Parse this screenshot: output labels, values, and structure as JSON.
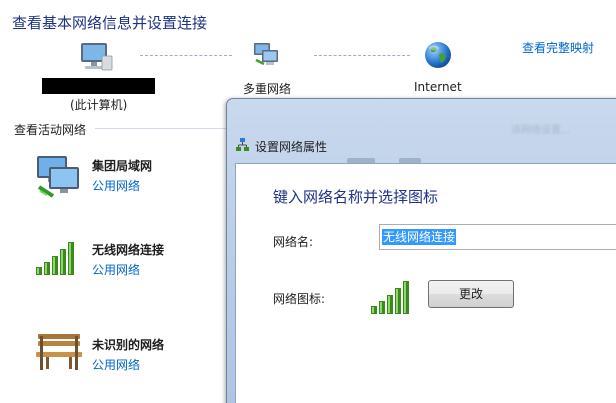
{
  "page": {
    "title": "查看基本网络信息并设置连接",
    "map_link": "查看完整映射"
  },
  "network_map": {
    "computer_label": "(此计算机)",
    "middle_label": "多重网络",
    "internet_label": "Internet"
  },
  "active_networks": {
    "header": "查看活动网络",
    "items": [
      {
        "name": "集团局域网",
        "type": "公用网络",
        "icon": "network-computers-icon"
      },
      {
        "name": "无线网络连接",
        "type": "公用网络",
        "icon": "wireless-signal-icon"
      },
      {
        "name": "未识别的网络",
        "type": "公用网络",
        "icon": "park-bench-icon"
      }
    ]
  },
  "dialog": {
    "title": "设置网络属性",
    "heading": "键入网络名称并选择图标",
    "name_label": "网络名:",
    "name_value": "无线网络连接",
    "icon_label": "网络图标:",
    "change_button": "更改",
    "background_text": "该网络设置..."
  },
  "colors": {
    "title_blue": "#1e3287",
    "link_blue": "#0066cc",
    "selection_blue": "#3399ff",
    "signal_green": "#3a8a1e"
  }
}
